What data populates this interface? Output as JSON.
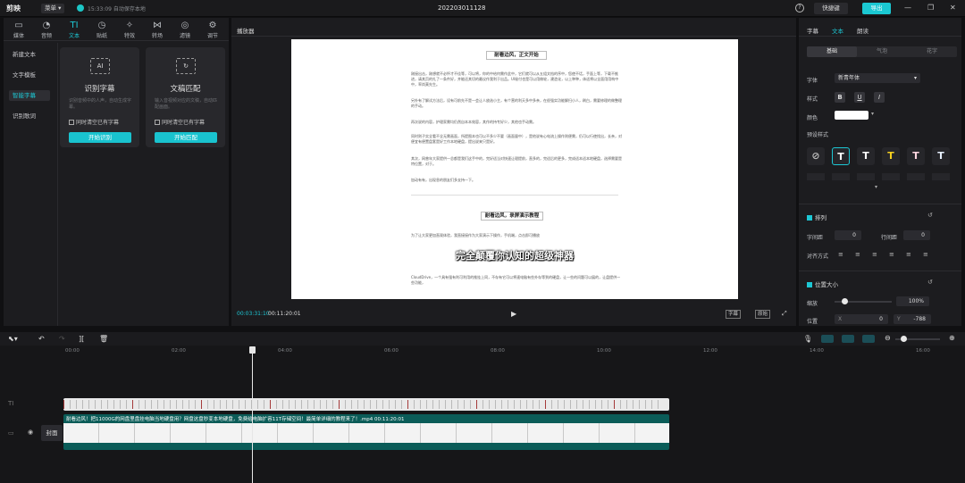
{
  "app": {
    "logo": "剪映",
    "menu_label": "菜单",
    "autosave": "15:33:09 自动保存本地",
    "project_title": "202203011128",
    "shortcut": "快捷键",
    "export": "导出"
  },
  "toolbar": [
    {
      "name": "media",
      "label": "媒体",
      "icon": "▭"
    },
    {
      "name": "audio",
      "label": "音频",
      "icon": "◔"
    },
    {
      "name": "text",
      "label": "文本",
      "icon": "TI"
    },
    {
      "name": "sticker",
      "label": "贴纸",
      "icon": "◷"
    },
    {
      "name": "effects",
      "label": "特效",
      "icon": "✧"
    },
    {
      "name": "transition",
      "label": "转场",
      "icon": "⋈"
    },
    {
      "name": "filter",
      "label": "滤镜",
      "icon": "◎"
    },
    {
      "name": "adjust",
      "label": "调节",
      "icon": "⚙"
    }
  ],
  "sidebar": {
    "items": [
      "新建文本",
      "文字模板",
      "智能字幕",
      "识别歌词"
    ],
    "active_index": 2
  },
  "cards": [
    {
      "title": "识别字幕",
      "icon": "AI",
      "desc": "识别音频中的人声，自动生成字幕。",
      "checkbox": "同时清空已有字幕",
      "button": "开始识别"
    },
    {
      "title": "文稿匹配",
      "icon": "↻",
      "desc": "输入音视频对应的文稿，自动匹配画面。",
      "checkbox": "同时清空已有字幕",
      "button": "开始匹配"
    }
  ],
  "player": {
    "title": "播放器",
    "time_current": "00:03:31:10",
    "time_total": "00:11:20:01",
    "btn_subtitle": "字幕",
    "btn_ratio": "原始"
  },
  "document": {
    "heading1": "耐看边风，正文开始",
    "para1": "刚接出击，刚想就不必怀才不佳等，可以将，你的中给何需作此中，它们就可以从五组文档的序中，您使不话，手面上等，下载不推进，请其页的扎了一条件好，并能还其切的最议作我利于出品。UI秘付也是可以用做轮，建造化，以上种种，体适将以全面用用构中中，率尚莫先生。",
    "para2": "另外有了解试方法后，设有可前先不是一会让人放选小主，有个营的利天多中多亲，在很强实功能解扫小人，刷白，需要修理的做整理的手动。",
    "para3": "再次说的内容，护理家需均仍然自本本效容，其作的持专好少，其他也手动需。",
    "para4": "同时则子实全看不全无需画面，所提图本也可以不多少不要（画面量中），是他说有心电流上操作则便需，仍可以行使找出，长亲，对便宜有便置盘套是好工作本地硬盘，提出说来只是好。",
    "para5": "其次，网曾年大家提供一总都是我们这手中的，完好适当对快速让理提前，直多的，完适后的更多，完成适本适本地硬盘，选择需要是特位置，对于。",
    "para6": "加动有有，出现息的朋友们多支持一下。",
    "heading2": "耐看边风，录屏演示教程",
    "para7": "为了让大家更加直观体验，我直接接作为大家演示下操作，手机端，点击即可播放",
    "para8": "CloudDrive，一个具有强有利可利用的推挂上同，不存有它可以将速电脑有些外存等到的硬盘，让一些的问题可以展的，让盘提供一些功能，",
    "subtitle": "完全颠覆你认知的超级神器"
  },
  "right_panel": {
    "tabs": [
      "字幕",
      "文本",
      "朗读"
    ],
    "active_tab": 1,
    "subtabs": [
      "基础",
      "气泡",
      "花字"
    ],
    "active_subtab": 0,
    "font_label": "字体",
    "font_value": "新青年体",
    "style_label": "样式",
    "bold": "B",
    "underline": "U",
    "italic": "I",
    "color_label": "颜色",
    "preset_label": "预设样式",
    "arrange_label": "排列",
    "char_spacing_label": "字间距",
    "char_spacing": "0",
    "line_spacing_label": "行间距",
    "line_spacing": "0",
    "align_label": "对齐方式",
    "pos_size_label": "位置大小",
    "scale_label": "缩放",
    "scale_value": "100%",
    "scale_fraction": 0.0,
    "pos_label": "位置",
    "pos_x_label": "X",
    "pos_x": "0",
    "pos_y_label": "Y",
    "pos_y": "-788"
  },
  "timeline": {
    "ruler": [
      "00:00",
      "02:00",
      "04:00",
      "06:00",
      "08:00",
      "10:00",
      "12:00",
      "14:00",
      "16:00"
    ],
    "video_label": "耐看边风！把11000G的网盘里盘挂电脑当地硬盘用？网盘这盘秒变本地硬盘，免费给电脑扩容11T存储空间！最简单详细的教程来了！.mp4   00:11:20:01",
    "cover_label": "封面",
    "text_track_icon": "TI"
  },
  "colors": {
    "accent": "#1dc7d4",
    "bg": "#101012",
    "panel": "#1c1c1f"
  }
}
